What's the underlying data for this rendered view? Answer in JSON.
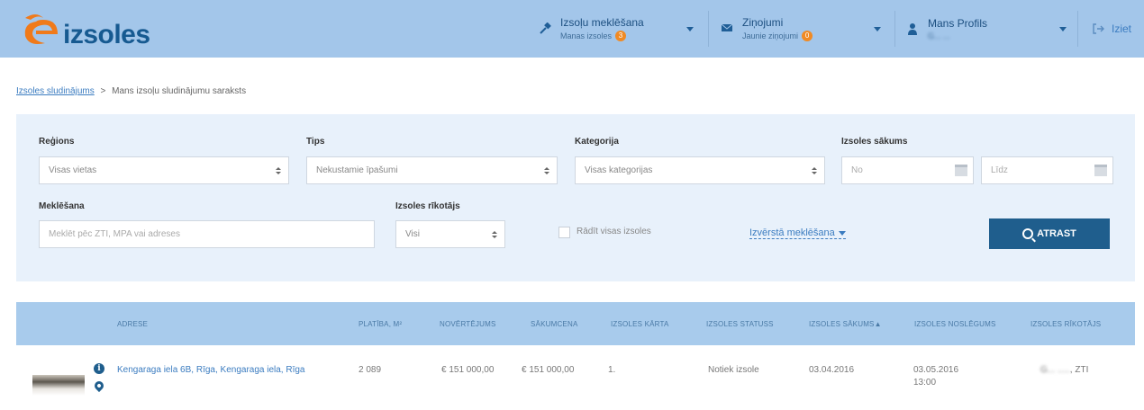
{
  "header": {
    "logo_text": "izsoles",
    "nav": [
      {
        "title": "Izsoļu meklēšana",
        "subtitle": "Manas izsoles",
        "badge": "3",
        "icon": "hammer-icon"
      },
      {
        "title": "Ziņojumi",
        "subtitle": "Jaunie ziņojumi",
        "badge": "0",
        "icon": "envelope-icon"
      },
      {
        "title": "Mans Profils",
        "subtitle": "G... ...",
        "icon": "user-icon"
      }
    ],
    "logout_label": "Iziet"
  },
  "breadcrumb": {
    "link": "Izsoles sludinājums",
    "separator": ">",
    "current": "Mans izsoļu sludinājumu saraksts"
  },
  "filters": {
    "region_label": "Reģions",
    "region_value": "Visas vietas",
    "type_label": "Tips",
    "type_value": "Nekustamie īpašumi",
    "category_label": "Kategorija",
    "category_value": "Visas kategorijas",
    "start_label": "Izsoles sākums",
    "from_placeholder": "No",
    "to_placeholder": "Līdz",
    "search_label": "Meklēšana",
    "search_placeholder": "Meklēt pēc ZTI, MPA vai adreses",
    "organizer_label": "Izsoles rīkotājs",
    "organizer_value": "Visi",
    "show_all_label": "Rādīt visas izsoles",
    "advanced_label": "Izvērstā meklēšana",
    "search_button": "ATRAST"
  },
  "table": {
    "columns": [
      "ADRESE",
      "PLATĪBA, m²",
      "NOVĒRTĒJUMS",
      "SĀKUMCENA",
      "IZSOLES KĀRTA",
      "IZSOLES STATUSS",
      "IZSOLES SĀKUMS▲",
      "IZSOLES NOSLĒGUMS",
      "IZSOLES RĪKOTĀJS"
    ],
    "rows": [
      {
        "address": "Kengaraga iela 6B, Rīga, Kengaraga iela, Rīga",
        "area": "2 089",
        "valuation": "€ 151 000,00",
        "start_price": "€ 151 000,00",
        "round": "1.",
        "status": "Notiek izsole",
        "start": "03.04.2016",
        "end_date": "03.05.2016",
        "end_time": "13:00",
        "organizer_blurred": "G... .....",
        "organizer_suffix": ", ZTI"
      }
    ]
  }
}
